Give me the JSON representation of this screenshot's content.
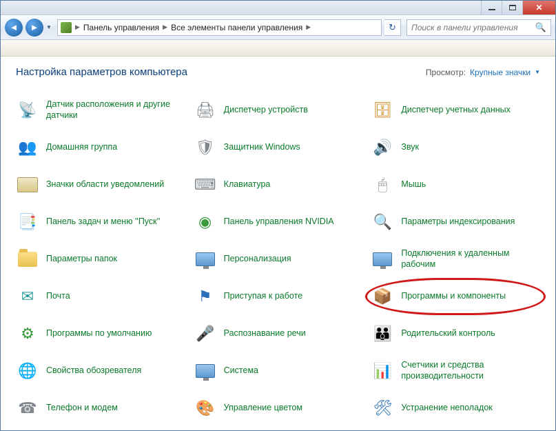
{
  "window": {
    "breadcrumb": {
      "item1": "Панель управления",
      "item2": "Все элементы панели управления"
    },
    "search_placeholder": "Поиск в панели управления"
  },
  "header": {
    "title": "Настройка параметров компьютера",
    "view_label": "Просмотр:",
    "view_value": "Крупные значки"
  },
  "items": [
    {
      "label": "Датчик расположения и другие датчики",
      "icon": "📡",
      "cls": "ic-orange"
    },
    {
      "label": "Диспетчер устройств",
      "icon": "🖨",
      "cls": "ic-gray"
    },
    {
      "label": "Диспетчер учетных данных",
      "icon": "🗄",
      "cls": "ic-orange"
    },
    {
      "label": "Домашняя группа",
      "icon": "👥",
      "cls": "ic-blue"
    },
    {
      "label": "Защитник Windows",
      "icon": "🛡",
      "cls": "ic-gray"
    },
    {
      "label": "Звук",
      "icon": "🔊",
      "cls": "ic-gray"
    },
    {
      "label": "Значки области уведомлений",
      "icon": "▭",
      "cls": "ic-gray"
    },
    {
      "label": "Клавиатура",
      "icon": "⌨",
      "cls": "ic-gray"
    },
    {
      "label": "Мышь",
      "icon": "🖱",
      "cls": "ic-gray"
    },
    {
      "label": "Панель задач и меню ''Пуск''",
      "icon": "📑",
      "cls": "ic-blue"
    },
    {
      "label": "Панель управления NVIDIA",
      "icon": "◉",
      "cls": "ic-green"
    },
    {
      "label": "Параметры индексирования",
      "icon": "🔍",
      "cls": "ic-blue"
    },
    {
      "label": "Параметры папок",
      "icon": "folder",
      "cls": ""
    },
    {
      "label": "Персонализация",
      "icon": "monitor",
      "cls": ""
    },
    {
      "label": "Подключения к удаленным рабочим",
      "icon": "monitor",
      "cls": ""
    },
    {
      "label": "Почта",
      "icon": "✉",
      "cls": "ic-teal"
    },
    {
      "label": "Приступая к работе",
      "icon": "⚑",
      "cls": "ic-blue"
    },
    {
      "label": "Программы и компоненты",
      "icon": "📦",
      "cls": "ic-orange",
      "circled": true
    },
    {
      "label": "Программы по умолчанию",
      "icon": "⚙",
      "cls": "ic-green"
    },
    {
      "label": "Распознавание речи",
      "icon": "🎤",
      "cls": "ic-gray"
    },
    {
      "label": "Родительский контроль",
      "icon": "👪",
      "cls": "ic-orange"
    },
    {
      "label": "Свойства обозревателя",
      "icon": "🌐",
      "cls": "ic-blue"
    },
    {
      "label": "Система",
      "icon": "monitor",
      "cls": ""
    },
    {
      "label": "Счетчики и средства производительности",
      "icon": "📊",
      "cls": "ic-gray"
    },
    {
      "label": "Телефон и модем",
      "icon": "☎",
      "cls": "ic-gray"
    },
    {
      "label": "Управление цветом",
      "icon": "🎨",
      "cls": "ic-orange"
    },
    {
      "label": "Устранение неполадок",
      "icon": "🛠",
      "cls": "ic-blue"
    }
  ]
}
